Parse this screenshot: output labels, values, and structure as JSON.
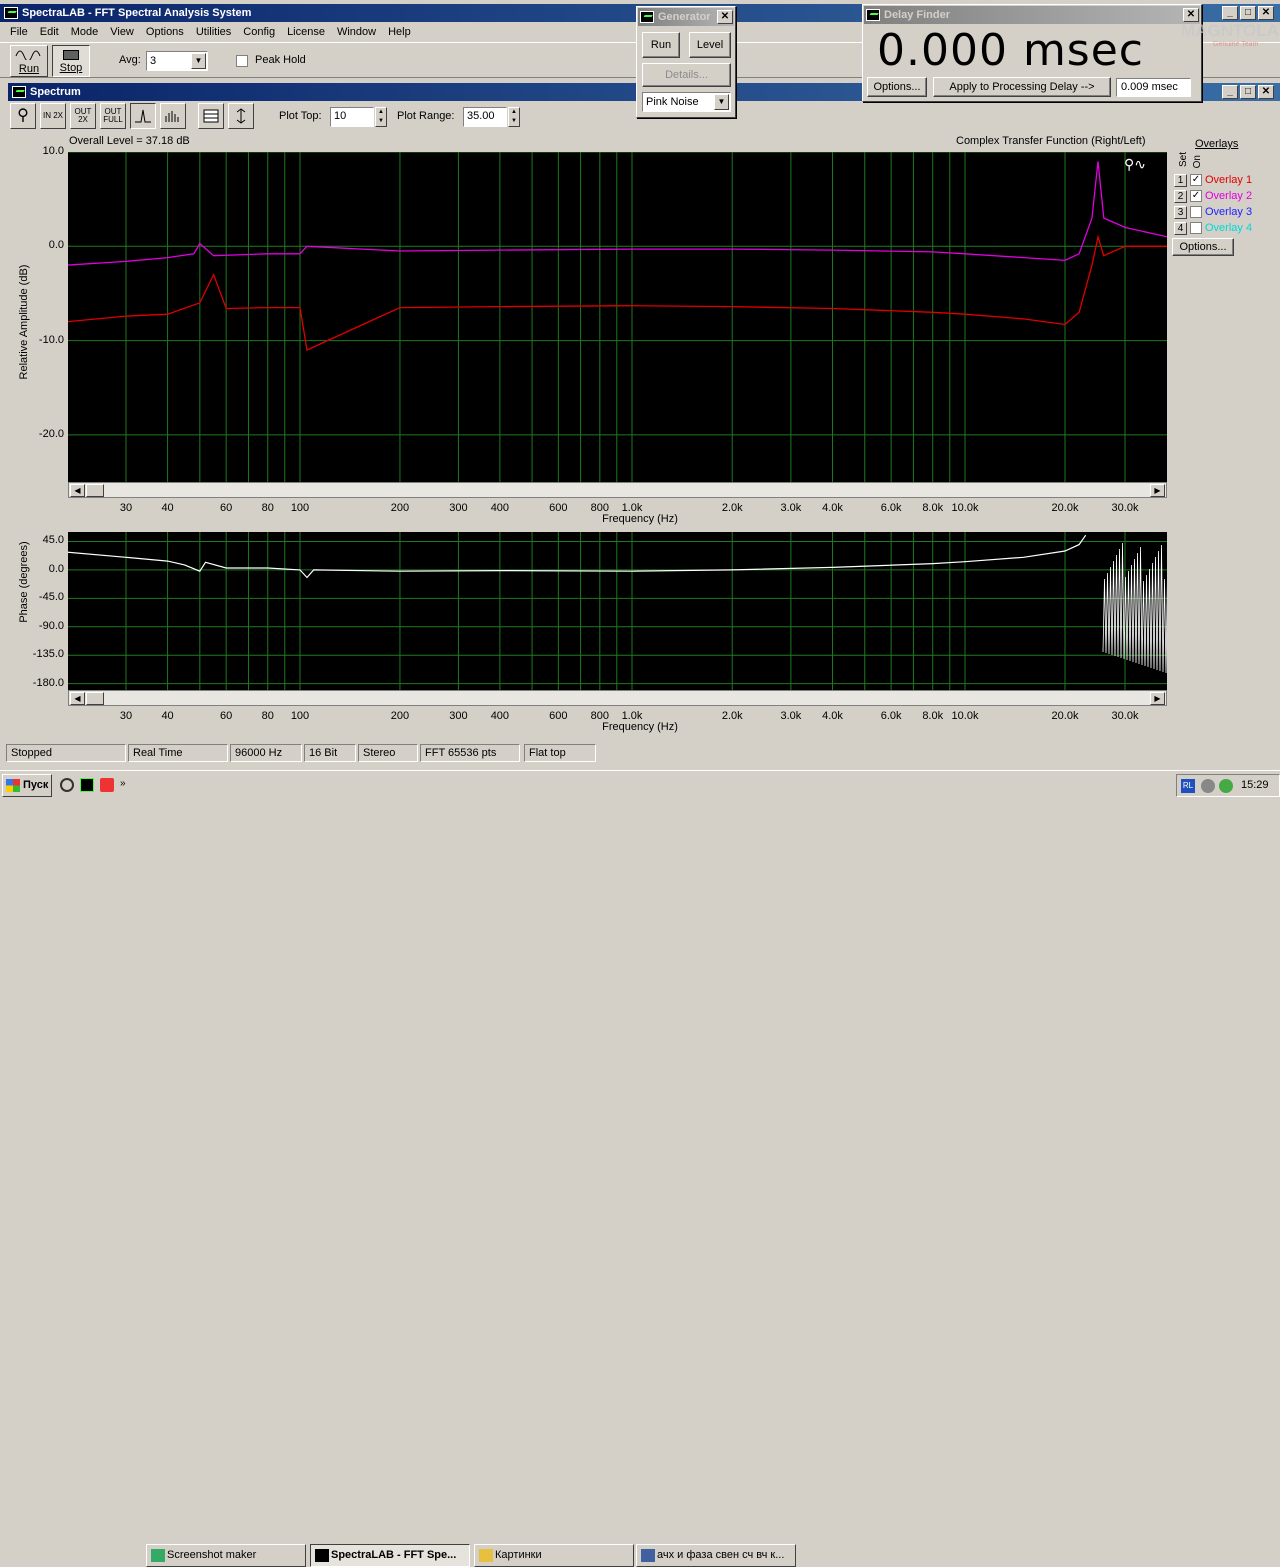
{
  "app": {
    "title": "SpectraLAB - FFT Spectral Analysis System"
  },
  "menu": [
    "File",
    "Edit",
    "Mode",
    "View",
    "Options",
    "Utilities",
    "Config",
    "License",
    "Window",
    "Help"
  ],
  "toolbar": {
    "run_label": "Run",
    "stop_label": "Stop",
    "avg_label": "Avg:",
    "avg_value": "3",
    "peak_hold_label": "Peak Hold"
  },
  "generator": {
    "title": "Generator",
    "run": "Run",
    "level": "Level",
    "details": "Details...",
    "signal": "Pink Noise"
  },
  "delay": {
    "title": "Delay Finder",
    "value": "0.000 msec",
    "options": "Options...",
    "apply": "Apply to Processing Delay -->",
    "result": "0.009 msec",
    "watermark": "MAGNTOLA",
    "watermark_sub": "Genuine Team"
  },
  "spectrum": {
    "title": "Spectrum",
    "plot_top_label": "Plot Top:",
    "plot_top_value": "10",
    "plot_range_label": "Plot Range:",
    "plot_range_value": "35.00",
    "tool_icons": [
      "zoom-icon",
      "zoom-in-2x-icon",
      "zoom-out-2x-icon",
      "zoom-out-full-icon",
      "line-mode-icon",
      "bar-mode-icon",
      "table-icon",
      "autoscale-icon"
    ],
    "tool_labels": [
      "",
      "IN 2X",
      "OUT 2X",
      "OUT FULL",
      "",
      "",
      "",
      ""
    ],
    "overall_level": "Overall Level = 37.18 dB",
    "function_label": "Complex Transfer Function (Right/Left)",
    "amp_ylabel": "Relative Amplitude (dB)",
    "phase_ylabel": "Phase (degrees)",
    "xlabel": "Frequency (Hz)",
    "amp_yticks": [
      "10.0",
      "0.0",
      "-10.0",
      "-20.0"
    ],
    "phase_yticks": [
      "45.0",
      "0.0",
      "-45.0",
      "-90.0",
      "-135.0",
      "-180.0"
    ],
    "xticks": [
      "30",
      "40",
      "60",
      "80",
      "100",
      "200",
      "300",
      "400",
      "600",
      "800",
      "1.0k",
      "2.0k",
      "3.0k",
      "4.0k",
      "6.0k",
      "8.0k",
      "10.0k",
      "20.0k",
      "30.0k"
    ]
  },
  "overlays": {
    "title": "Overlays",
    "set_label": "Set",
    "on_label": "On",
    "items": [
      {
        "num": "1",
        "label": "Overlay 1",
        "checked": "✓",
        "color": "#e00000"
      },
      {
        "num": "2",
        "label": "Overlay 2",
        "checked": "✓",
        "color": "#e000e0"
      },
      {
        "num": "3",
        "label": "Overlay 3",
        "checked": "",
        "color": "#2020ff"
      },
      {
        "num": "4",
        "label": "Overlay 4",
        "checked": "",
        "color": "#00d8d8"
      }
    ],
    "options": "Options..."
  },
  "chart_data": [
    {
      "type": "line",
      "title": "Complex Transfer Function (Right/Left)",
      "xlabel": "Frequency (Hz)",
      "ylabel": "Relative Amplitude (dB)",
      "xscale": "log",
      "xlim": [
        20,
        45000
      ],
      "ylim": [
        -25,
        10
      ],
      "series": [
        {
          "name": "Overlay 1",
          "color": "#e00000",
          "x": [
            20,
            30,
            40,
            50,
            55,
            60,
            80,
            100,
            105,
            200,
            400,
            1000,
            2000,
            4000,
            8000,
            10000,
            15000,
            20000,
            22000,
            24000,
            25000,
            26000,
            30000,
            40000
          ],
          "y": [
            -8,
            -7.4,
            -7.2,
            -6,
            -3,
            -6.6,
            -6.5,
            -6.5,
            -11,
            -6.5,
            -6.4,
            -6.3,
            -6.4,
            -6.6,
            -7,
            -7.2,
            -7.7,
            -8.3,
            -7,
            -2,
            1,
            -1,
            0,
            0
          ]
        },
        {
          "name": "Overlay 2",
          "color": "#e000e0",
          "x": [
            20,
            30,
            40,
            48,
            50,
            55,
            80,
            100,
            105,
            200,
            400,
            1000,
            2000,
            4000,
            8000,
            10000,
            15000,
            20000,
            22000,
            24000,
            25000,
            26000,
            30000,
            40000
          ],
          "y": [
            -2,
            -1.6,
            -1.2,
            -0.8,
            0.3,
            -1,
            -0.8,
            -0.8,
            0,
            -0.5,
            -0.4,
            -0.3,
            -0.3,
            -0.4,
            -0.6,
            -0.8,
            -1.2,
            -1.5,
            -0.8,
            3,
            9,
            3,
            2,
            1
          ]
        }
      ]
    },
    {
      "type": "line",
      "xlabel": "Frequency (Hz)",
      "ylabel": "Phase (degrees)",
      "xscale": "log",
      "xlim": [
        20,
        45000
      ],
      "ylim": [
        -190,
        60
      ],
      "series": [
        {
          "color": "#ffffff",
          "x": [
            20,
            30,
            40,
            45,
            50,
            52,
            60,
            80,
            100,
            105,
            110,
            200,
            400,
            1000,
            2000,
            4000,
            8000,
            10000,
            15000,
            20000,
            22000,
            23000
          ],
          "y": [
            28,
            20,
            14,
            8,
            -2,
            12,
            3,
            3,
            0,
            -12,
            0,
            -2,
            -1,
            -2,
            0,
            4,
            10,
            13,
            20,
            30,
            40,
            55
          ]
        }
      ]
    }
  ],
  "status": [
    "Stopped",
    "Real Time",
    "96000 Hz",
    "16 Bit",
    "Stereo",
    "FFT 65536 pts",
    "Flat top"
  ],
  "taskbar": {
    "start": "Пуск",
    "items": [
      "Screenshot maker",
      "SpectraLAB - FFT Spe...",
      "Картинки",
      "ачх и фаза свен сч вч к..."
    ],
    "lang": "RL",
    "clock": "15:29"
  }
}
